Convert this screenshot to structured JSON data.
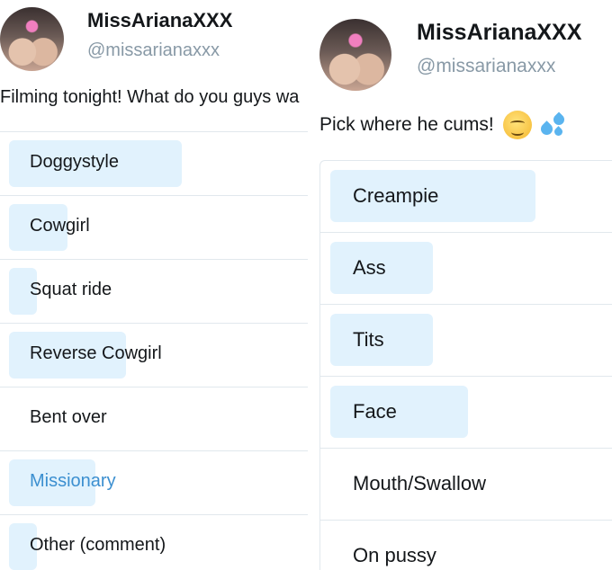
{
  "left_tweet": {
    "display_name": "MissArianaXXX",
    "handle": "@missarianaxxx",
    "text": "Filming tonight! What do you guys wa",
    "avatar_icon": "avatar-photo",
    "bar_color": "#e1f2fd",
    "poll": {
      "options": [
        {
          "label": "Doggystyle",
          "share_pct": 56
        },
        {
          "label": "Cowgirl",
          "share_pct": 19
        },
        {
          "label": "Squat ride",
          "share_pct": 9
        },
        {
          "label": "Reverse Cowgirl",
          "share_pct": 38
        },
        {
          "label": "Bent over",
          "share_pct": 0
        },
        {
          "label": "Missionary",
          "share_pct": 28,
          "selected": true,
          "selected_color": "#3b8fd0"
        },
        {
          "label": "Other (comment)",
          "share_pct": 9
        }
      ]
    }
  },
  "right_tweet": {
    "display_name": "MissArianaXXX",
    "handle": "@missarianaxxx",
    "text": "Pick where he cums!",
    "emojis": [
      "drooling-face-icon",
      "sweat-droplets-icon"
    ],
    "avatar_icon": "avatar-photo",
    "bar_color": "#e1f2fd",
    "poll": {
      "options": [
        {
          "label": "Creampie",
          "share_pct": 70
        },
        {
          "label": "Ass",
          "share_pct": 35
        },
        {
          "label": "Tits",
          "share_pct": 35
        },
        {
          "label": "Face",
          "share_pct": 47
        },
        {
          "label": "Mouth/Swallow",
          "share_pct": 0
        },
        {
          "label": "On pussy",
          "share_pct": 0
        }
      ]
    }
  }
}
